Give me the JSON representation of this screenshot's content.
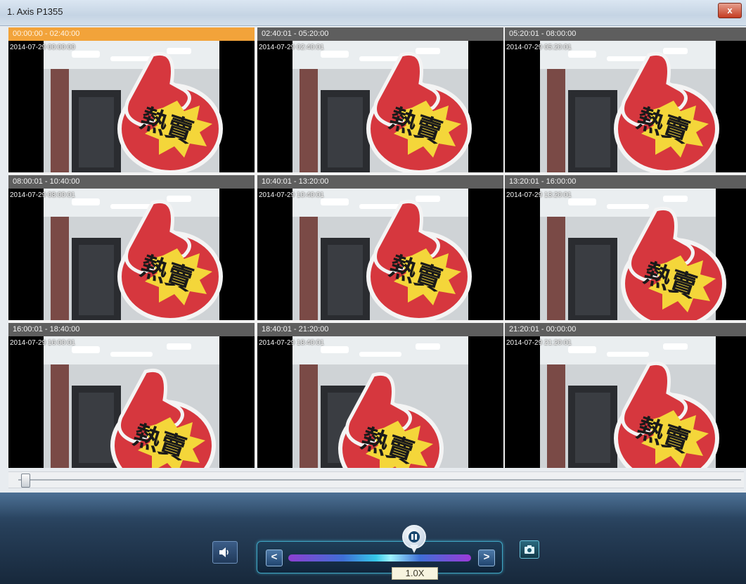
{
  "window": {
    "title": "1. Axis P1355",
    "close_label": "x"
  },
  "tiles": [
    {
      "range": "00:00:00 - 02:40:00",
      "stamp": "2014-07-29 00:00:00"
    },
    {
      "range": "02:40:01 - 05:20:00",
      "stamp": "2014-07-29 02:40:01"
    },
    {
      "range": "05:20:01 - 08:00:00",
      "stamp": "2014-07-29 05:20:01"
    },
    {
      "range": "08:00:01 - 10:40:00",
      "stamp": "2014-07-29 08:00:01"
    },
    {
      "range": "10:40:01 - 13:20:00",
      "stamp": "2014-07-29 10:40:01"
    },
    {
      "range": "13:20:01 - 16:00:00",
      "stamp": "2014-07-29 13:20:01"
    },
    {
      "range": "16:00:01 - 18:40:00",
      "stamp": "2014-07-29 16:00:01"
    },
    {
      "range": "18:40:01 - 21:20:00",
      "stamp": "2014-07-29 18:40:01"
    },
    {
      "range": "21:20:01 - 00:00:00",
      "stamp": "2014-07-29 21:20:01"
    }
  ],
  "active_tile": 0,
  "sign_text": "熱賣",
  "timeline": {
    "position": 0.0
  },
  "controls": {
    "speaker_icon": "speaker-icon",
    "prev_label": "<",
    "next_label": ">",
    "speed_label": "1.0X",
    "pause_icon": "pause-icon",
    "snapshot_icon": "snapshot-icon"
  }
}
